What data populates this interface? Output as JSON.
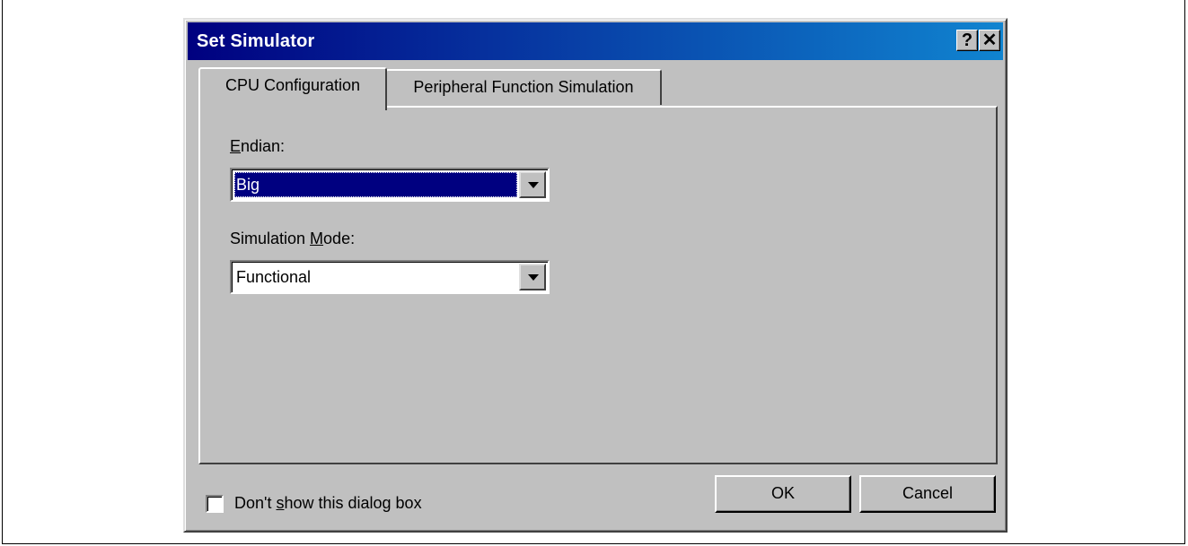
{
  "dialog": {
    "title": "Set Simulator",
    "help_label": "?",
    "close_label": "✕"
  },
  "tabs": [
    {
      "label": "CPU Configuration",
      "active": true
    },
    {
      "label": "Peripheral Function Simulation",
      "active": false
    }
  ],
  "endian": {
    "label_mnemonic": "E",
    "label_rest": "ndian:",
    "value": "Big"
  },
  "simulation_mode": {
    "label_before": "Simulation ",
    "label_mnemonic": "M",
    "label_after": "ode:",
    "value": "Functional"
  },
  "dont_show": {
    "label_before": "Don't ",
    "label_mnemonic": "s",
    "label_after": "how this dialog box",
    "checked": false
  },
  "buttons": {
    "ok": "OK",
    "cancel": "Cancel"
  },
  "colors": {
    "title_start": "#000080",
    "title_end": "#1084d0",
    "face": "#c0c0c0",
    "selection": "#000080"
  }
}
